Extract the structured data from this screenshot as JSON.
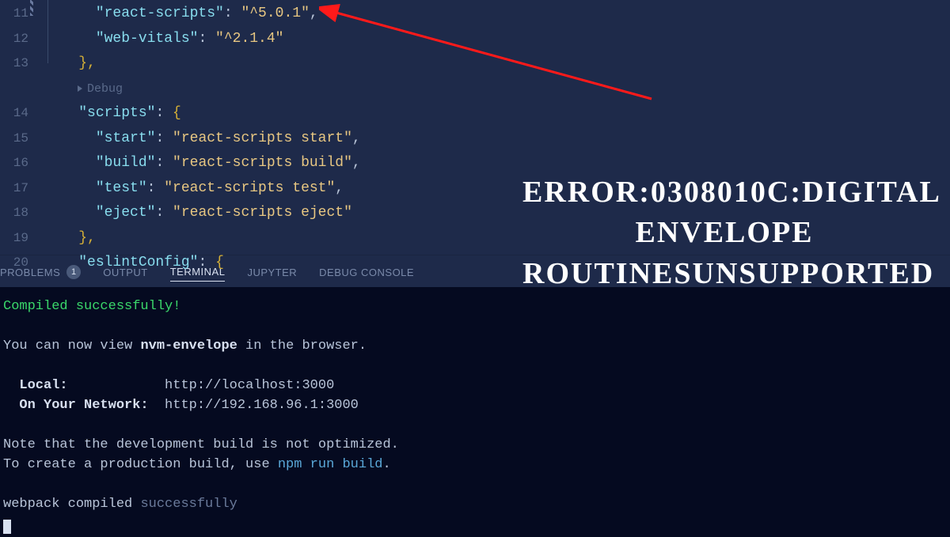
{
  "editor": {
    "lines": [
      {
        "num": "11",
        "indent": "      ",
        "key": "\"react-scripts\"",
        "sep": ": ",
        "val": "\"^5.0.1\"",
        "trail": ","
      },
      {
        "num": "12",
        "indent": "      ",
        "key": "\"web-vitals\"",
        "sep": ": ",
        "val": "\"^2.1.4\"",
        "trail": ""
      },
      {
        "num": "13",
        "indent": "    ",
        "closeBrace": "},",
        "isClose": true
      },
      {
        "num": "",
        "debugHint": "Debug"
      },
      {
        "num": "14",
        "indent": "    ",
        "key": "\"scripts\"",
        "sep": ": ",
        "openBrace": "{"
      },
      {
        "num": "15",
        "indent": "      ",
        "key": "\"start\"",
        "sep": ": ",
        "val": "\"react-scripts start\"",
        "trail": ","
      },
      {
        "num": "16",
        "indent": "      ",
        "key": "\"build\"",
        "sep": ": ",
        "val": "\"react-scripts build\"",
        "trail": ","
      },
      {
        "num": "17",
        "indent": "      ",
        "key": "\"test\"",
        "sep": ": ",
        "val": "\"react-scripts test\"",
        "trail": ","
      },
      {
        "num": "18",
        "indent": "      ",
        "key": "\"eject\"",
        "sep": ": ",
        "val": "\"react-scripts eject\"",
        "trail": ""
      },
      {
        "num": "19",
        "indent": "    ",
        "closeBrace": "},",
        "isClose": true
      },
      {
        "num": "20",
        "indent": "    ",
        "key": "\"eslintConfig\"",
        "sep": ": ",
        "openBrace": "{"
      }
    ]
  },
  "tabs": {
    "problems": "PROBLEMS",
    "problemsCount": "1",
    "output": "OUTPUT",
    "terminal": "TERMINAL",
    "jupyter": "JUPYTER",
    "debugConsole": "DEBUG CONSOLE"
  },
  "terminal": {
    "compiled": "Compiled successfully!",
    "viewLine1": "You can now view ",
    "viewBold": "nvm-envelope",
    "viewLine2": " in the browser.",
    "localLabel": "  Local:            ",
    "localUrl": "http://localhost:3000",
    "networkLabel": "  On Your Network:  ",
    "networkUrl": "http://192.168.96.1:3000",
    "note1": "Note that the development build is not optimized.",
    "note2a": "To create a production build, use ",
    "note2cmd": "npm run build",
    "note2b": ".",
    "webpack1": "webpack compiled ",
    "webpack2": "successfully"
  },
  "overlay": {
    "errorText": "ERROR:0308010C:DIGITAL ENVELOPE ROUTINESUNSUPPORTED"
  }
}
